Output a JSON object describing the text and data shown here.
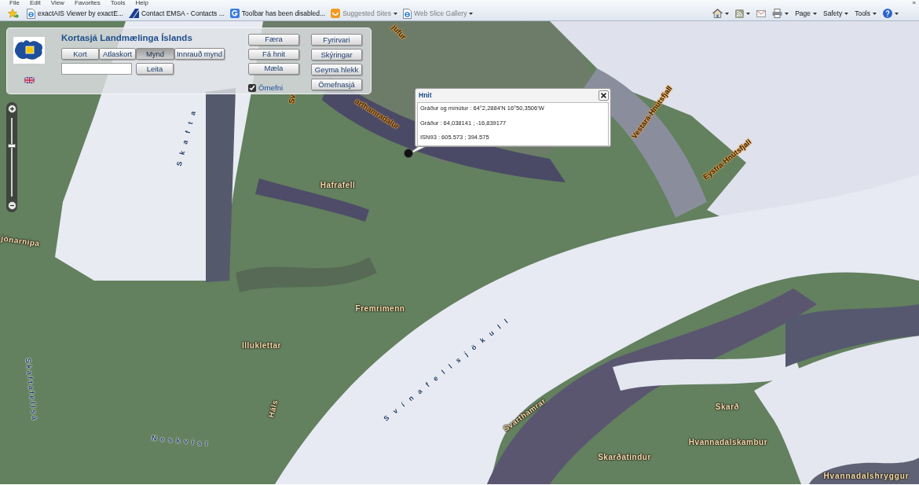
{
  "browser": {
    "menu": [
      "File",
      "Edit",
      "View",
      "Favorites",
      "Tools",
      "Help"
    ],
    "overflow": "»",
    "favorites": [
      {
        "kind": "page",
        "label": "exactAIS Viewer by exactE...",
        "dropdown": false,
        "disabled": false
      },
      {
        "kind": "triangle",
        "label": "Contact EMSA - Contacts ...",
        "dropdown": false,
        "disabled": false
      },
      {
        "kind": "square",
        "label": "Toolbar has been disabled...",
        "dropdown": false,
        "disabled": false
      },
      {
        "kind": "suggested",
        "label": "Suggested Sites",
        "dropdown": true,
        "disabled": true
      },
      {
        "kind": "page",
        "label": "Web Slice Gallery",
        "dropdown": true,
        "disabled": true
      }
    ],
    "commands": [
      {
        "kind": "home",
        "dropdown": true
      },
      {
        "kind": "feed",
        "dropdown": true
      },
      {
        "kind": "mail",
        "dropdown": false
      },
      {
        "kind": "print",
        "dropdown": true
      },
      {
        "kind": "text",
        "label": "Page",
        "dropdown": true
      },
      {
        "kind": "text",
        "label": "Safety",
        "dropdown": true
      },
      {
        "kind": "text",
        "label": "Tools",
        "dropdown": true
      },
      {
        "kind": "help",
        "dropdown": true
      }
    ]
  },
  "panel": {
    "title": "Kortasjá Landmælinga Íslands",
    "map_types": [
      {
        "label": "Kort",
        "selected": false
      },
      {
        "label": "Atlaskort",
        "selected": false
      },
      {
        "label": "Mynd",
        "selected": true
      },
      {
        "label": "Innrauð mynd",
        "selected": false
      }
    ],
    "search": {
      "button": "Leita"
    },
    "tools": [
      "Færa",
      "Fá hnit",
      "Mæla"
    ],
    "place_names": {
      "label": "Örnefni",
      "checked": true
    },
    "links": [
      "Fyrirvari",
      "Skýringar",
      "Geyma hlekk",
      "Örnefnasjá"
    ]
  },
  "zoom": {
    "level": 0.65
  },
  "popup": {
    "title": "Hnit",
    "lines": [
      "Gráður og mínútur : 64°2,2884'N 16°50,3506'W",
      "Gráður : 64,038141 ; -16,839177",
      "ISN93 : 605.573 ; 394.575"
    ]
  },
  "map_labels": [
    {
      "text": "jufur",
      "kind": "ridge"
    },
    {
      "text": "Sv",
      "kind": "ridge"
    },
    {
      "text": "Skafta",
      "kind": "water"
    },
    {
      "text": "arthamradalur",
      "kind": "ridge"
    },
    {
      "text": "Vestara-Hnútsfjall",
      "kind": "ridge"
    },
    {
      "text": "Hafrafell",
      "kind": "place"
    },
    {
      "text": "Eystra-Hnútsfjall",
      "kind": "ridge"
    },
    {
      "text": "jónarnípa",
      "kind": "place"
    },
    {
      "text": "Fremrimenn",
      "kind": "place"
    },
    {
      "text": "Svínafellsjökull",
      "kind": "water"
    },
    {
      "text": "Illuklettar",
      "kind": "place"
    },
    {
      "text": "Skaftafellsá",
      "kind": "water"
    },
    {
      "text": "Háls",
      "kind": "place"
    },
    {
      "text": "Svarthamrar",
      "kind": "place"
    },
    {
      "text": "Skarð",
      "kind": "place"
    },
    {
      "text": "Neskvísl",
      "kind": "water"
    },
    {
      "text": "Hvannadalskambur",
      "kind": "place"
    },
    {
      "text": "Skarðatindur",
      "kind": "place"
    },
    {
      "text": "Hvannadalshryggur",
      "kind": "place"
    }
  ]
}
